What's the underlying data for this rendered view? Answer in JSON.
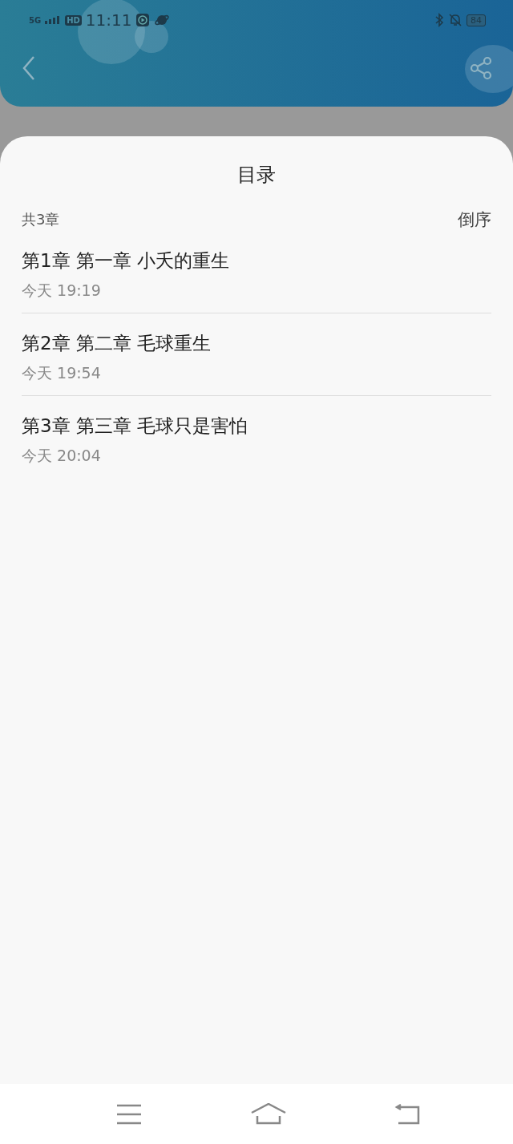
{
  "status_bar": {
    "network": "5G",
    "hd": "HD",
    "time": "11:11",
    "battery": "84"
  },
  "sheet": {
    "title": "目录",
    "count": "共3章",
    "sort": "倒序"
  },
  "chapters": [
    {
      "title": "第1章 第一章 小夭的重生",
      "time": "今天 19:19"
    },
    {
      "title": "第2章 第二章 毛球重生",
      "time": "今天 19:54"
    },
    {
      "title": "第3章 第三章 毛球只是害怕",
      "time": "今天 20:04"
    }
  ]
}
